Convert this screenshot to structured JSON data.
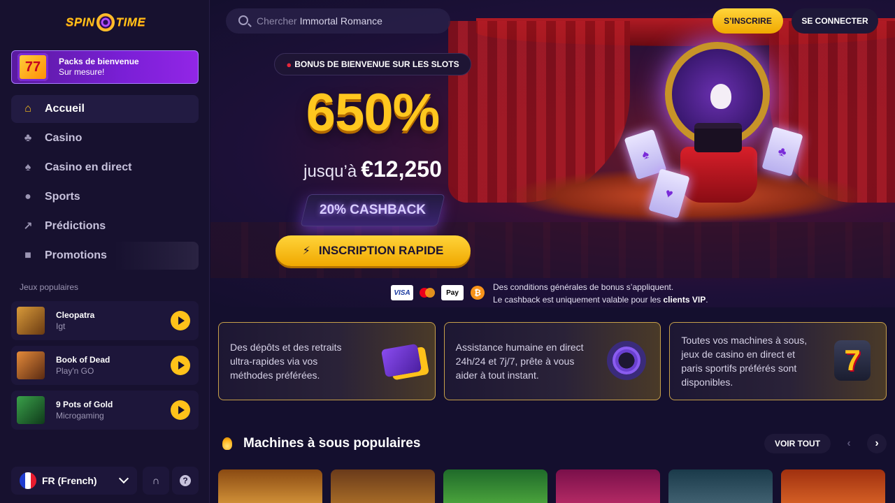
{
  "brand": {
    "logo_text_left": "SPIN",
    "logo_text_right": "TIME"
  },
  "welcome_pack": {
    "title": "Packs de bienvenue",
    "subtitle": "Sur mesure!",
    "icon": "slot-777-icon"
  },
  "nav": [
    {
      "label": "Accueil",
      "icon": "home-icon",
      "active": true
    },
    {
      "label": "Casino",
      "icon": "cherries-icon"
    },
    {
      "label": "Casino en direct",
      "icon": "live-cards-icon"
    },
    {
      "label": "Sports",
      "icon": "soccer-ball-icon"
    },
    {
      "label": "Prédictions",
      "icon": "chart-trend-icon"
    },
    {
      "label": "Promotions",
      "icon": "gift-icon"
    }
  ],
  "popular_games": {
    "heading": "Jeux populaires",
    "items": [
      {
        "name": "Cleopatra",
        "provider": "Igt",
        "thumb_color": "#8a5a22"
      },
      {
        "name": "Book of Dead",
        "provider": "Play'n GO",
        "thumb_color": "#b4621e"
      },
      {
        "name": "9 Pots of Gold",
        "provider": "Microgaming",
        "thumb_color": "#1f6a34"
      }
    ]
  },
  "language": {
    "label": "FR (French)"
  },
  "header": {
    "search_placeholder": "Chercher",
    "search_term": "Immortal Romance",
    "signup": "S’INSCRIRE",
    "login": "SE CONNECTER"
  },
  "hero": {
    "badge": "BONUS DE BIENVENUE SUR LES SLOTS",
    "percent": "650%",
    "up_to": "jusqu’à",
    "amount": "€12,250",
    "cashback": "20% CASHBACK",
    "cta": "INSCRIPTION RAPIDE"
  },
  "payments": {
    "visa": "VISA",
    "apple_pay": "Pay",
    "bitcoin": "₿"
  },
  "terms": {
    "line1": "Des conditions générales de bonus s’appliquent.",
    "line2_prefix": "Le cashback est uniquement valable pour les",
    "line2_bold": "clients VIP",
    "line2_suffix": "."
  },
  "features": [
    {
      "text": "Des dépôts et des retraits ultra-rapides via vos méthodes préférées.",
      "icon": "wallet-phone-icon"
    },
    {
      "text": "Assistance humaine en direct 24h/24 et 7j/7, prête à vous aider à tout instant.",
      "icon": "headset-icon"
    },
    {
      "text": "Toutes vos machines à sous, jeux de casino en direct et paris sportifs préférés sont disponibles.",
      "icon": "slot-seven-icon"
    }
  ],
  "slots_section": {
    "title": "Machines à sous populaires",
    "see_all": "VOIR TOUT",
    "tiles": [
      {
        "name": "eye-of-horus-tile",
        "color": "#c7782a"
      },
      {
        "name": "book-of-dead-tile",
        "color": "#8a5a2a"
      },
      {
        "name": "leprechaun-tile",
        "color": "#2a8a3a"
      },
      {
        "name": "gold-coins-tile",
        "color": "#a01a5a"
      },
      {
        "name": "vampire-tile",
        "color": "#2a4a5a"
      },
      {
        "name": "cowboy-tile",
        "color": "#c74a1a"
      }
    ]
  }
}
